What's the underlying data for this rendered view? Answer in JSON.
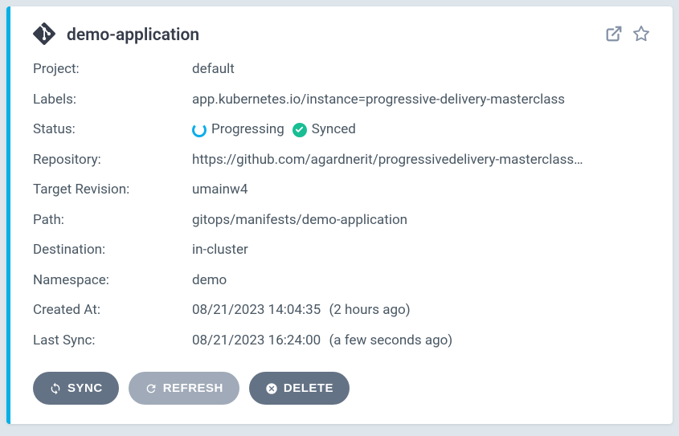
{
  "app": {
    "title": "demo-application"
  },
  "fields": {
    "project": {
      "label": "Project:",
      "value": "default"
    },
    "labels": {
      "label": "Labels:",
      "value": "app.kubernetes.io/instance=progressive-delivery-masterclass"
    },
    "status": {
      "label": "Status:",
      "progressing": "Progressing",
      "synced": "Synced"
    },
    "repository": {
      "label": "Repository:",
      "value": "https://github.com/agardnerit/progressivedelivery-masterclass…"
    },
    "target_revision": {
      "label": "Target Revision:",
      "value": "umainw4"
    },
    "path": {
      "label": "Path:",
      "value": "gitops/manifests/demo-application"
    },
    "destination": {
      "label": "Destination:",
      "value": "in-cluster"
    },
    "namespace": {
      "label": "Namespace:",
      "value": "demo"
    },
    "created_at": {
      "label": "Created At:",
      "value": "08/21/2023 14:04:35",
      "relative": "(2 hours ago)"
    },
    "last_sync": {
      "label": "Last Sync:",
      "value": "08/21/2023 16:24:00",
      "relative": "(a few seconds ago)"
    }
  },
  "actions": {
    "sync": "SYNC",
    "refresh": "REFRESH",
    "delete": "DELETE"
  }
}
